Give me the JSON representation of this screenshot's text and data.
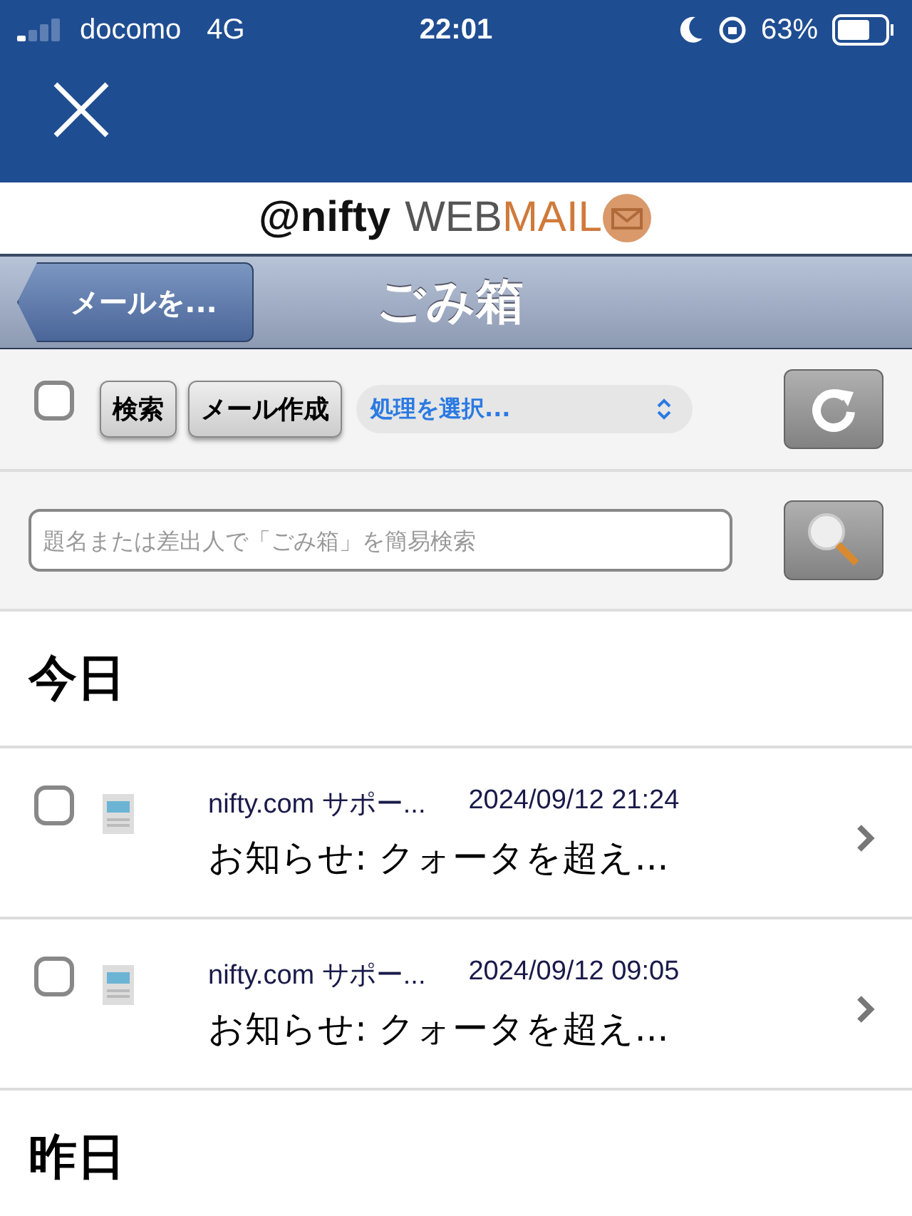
{
  "status_bar": {
    "carrier": "docomo",
    "network": "4G",
    "time": "22:01",
    "battery": "63%"
  },
  "logo": {
    "brand": "@nifty",
    "part_1": "WEB",
    "part_2": "MAIL"
  },
  "nav_bar": {
    "back": "メールを...",
    "title": "ごみ箱"
  },
  "toolbar": {
    "select_all": {
      "checked": false
    },
    "buttons": [
      "検索",
      "メール作成"
    ],
    "action_select": "処理を選択..."
  },
  "search": {
    "placeholder": "題名または差出人で「ごみ箱」を簡易検索"
  },
  "groups": [
    {
      "heading": "今日",
      "mails": [
        {
          "checked": false,
          "sender": "nifty.com サポー...",
          "date": "2024/09/12 21:24",
          "subject": "お知らせ: クォータを超え..."
        },
        {
          "checked": false,
          "sender": "nifty.com サポー...",
          "date": "2024/09/12 09:05",
          "subject": "お知らせ: クォータを超え..."
        }
      ]
    },
    {
      "heading": "昨日"
    }
  ]
}
